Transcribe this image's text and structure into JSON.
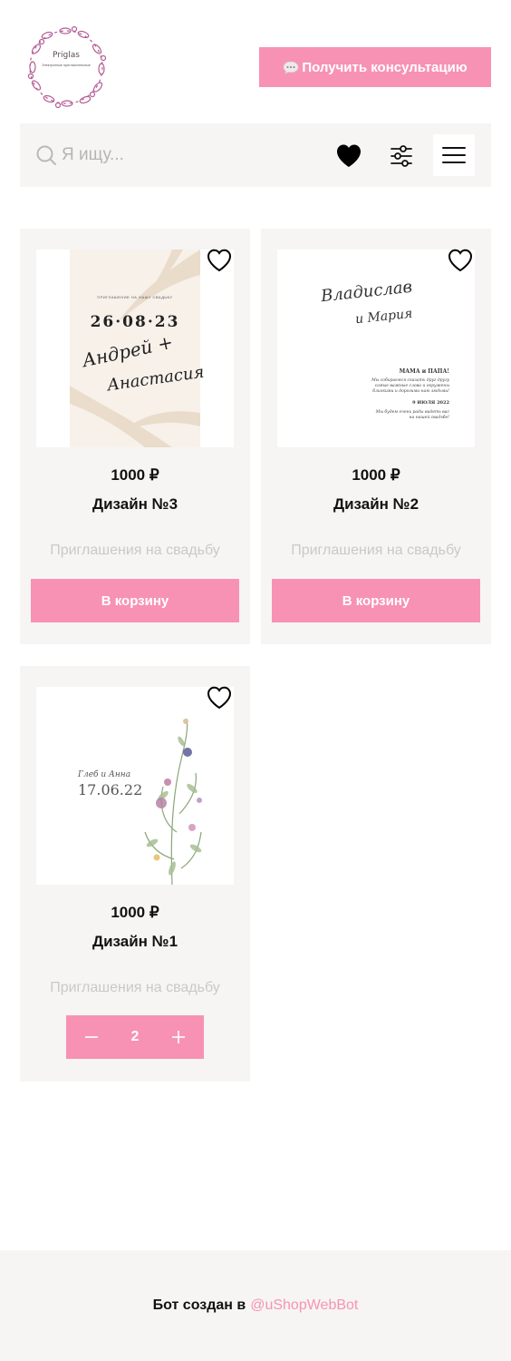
{
  "header": {
    "logo_text": "Priglas",
    "logo_subtext": "Электронные пригласительные",
    "consult_button": "Получить консультацию"
  },
  "search": {
    "placeholder": "Я ищу..."
  },
  "icons": {
    "search": "search-icon",
    "favorites": "heart-icon",
    "filter": "filter-sliders-icon",
    "menu": "hamburger-menu-icon",
    "chat": "chat-bubble-icon"
  },
  "colors": {
    "accent": "#f792b5",
    "panel": "#f6f5f4",
    "muted_text": "#c9c9c9"
  },
  "products": [
    {
      "price": "1000 ₽",
      "name": "Дизайн №3",
      "category": "Приглашения на свадьбу",
      "button": "В корзину",
      "image_text": {
        "top": "ПРИГЛАШЕНИЕ НА НАШУ СВАДЬБУ",
        "date": "26·08·23",
        "names_1": "Андрей +",
        "names_2": "Анастасия"
      }
    },
    {
      "price": "1000 ₽",
      "name": "Дизайн №2",
      "category": "Приглашения на свадьбу",
      "button": "В корзину",
      "image_text": {
        "names_1": "Владислав",
        "names_2": "и Мария",
        "heading": "МАМА и ПАПА!",
        "line1": "Мы собираемся сказать друг другу",
        "line2": "самые важные слова и окружены",
        "line3": "близкими и дорогими нам людьми!",
        "date": "9 ИЮЛЯ 2022",
        "line4": "Мы будем очень рады видеть вас",
        "line5": "на нашей свадьбе!"
      }
    },
    {
      "price": "1000 ₽",
      "name": "Дизайн №1",
      "category": "Приглашения на свадьбу",
      "quantity": "2",
      "image_text": {
        "names": "Глеб и Анна",
        "date": "17.06.22"
      }
    }
  ],
  "footer": {
    "prefix": "Бот создан в",
    "link": "@uShopWebBot"
  }
}
